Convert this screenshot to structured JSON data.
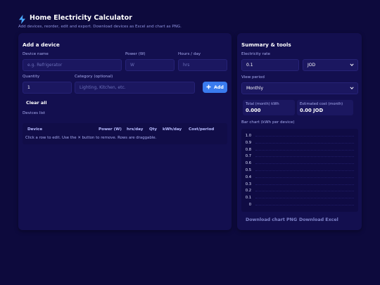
{
  "app": {
    "title": "Home Electricity Calculator",
    "subtitle": "Add devices, reorder, edit and export. Download devices as Excel and chart as PNG."
  },
  "add_device": {
    "heading": "Add a device",
    "device_name_label": "Device name",
    "device_name_placeholder": "e.g. Refrigerator",
    "power_label": "Power (W)",
    "power_placeholder": "W",
    "hours_label": "Hours / day",
    "hours_placeholder": "hrs",
    "quantity_label": "Quantity",
    "quantity_value": "1",
    "category_label": "Category (optional)",
    "category_placeholder": "Lighting, Kitchen, etc.",
    "add_button": "Add",
    "clear_all_button": "Clear all",
    "devices_list_label": "Devices list",
    "table_headers": [
      "Device",
      "Power (W)",
      "hrs/day",
      "Qty",
      "kWh/day",
      "Cost/period"
    ],
    "table_hint": "Click a row to edit. Use the ✕ button to remove. Rows are draggable."
  },
  "summary": {
    "heading": "Summary & tools",
    "rate_label": "Electricity rate",
    "rate_value": "0.1",
    "currency_value": "JOD",
    "view_period_label": "View period",
    "view_period_value": "Monthly",
    "total_label": "Total (month) kWh",
    "total_value": "0.000",
    "cost_label": "Estimated cost (month)",
    "cost_value": "0.00 JOD",
    "chart_label": "Bar chart (kWh per device)",
    "download_chart_button": "Download chart PNG",
    "download_excel_button": "Download Excel"
  },
  "chart_data": {
    "type": "bar",
    "categories": [],
    "values": [],
    "title": "",
    "xlabel": "",
    "ylabel": "",
    "ylim": [
      0,
      1.0
    ],
    "yticks": [
      "1.0",
      "0.9",
      "0.8",
      "0.7",
      "0.6",
      "0.5",
      "0.4",
      "0.3",
      "0.2",
      "0.1",
      "0"
    ],
    "grid": true
  },
  "colors": {
    "background": "#0d0a3d",
    "card": "#130f4f",
    "accent": "#3a7bef",
    "bolt": "#4aa8ff"
  }
}
